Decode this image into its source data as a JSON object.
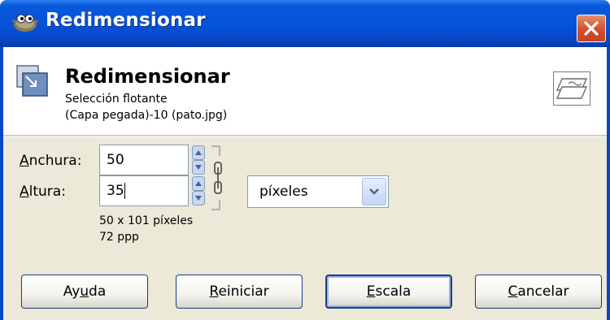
{
  "window": {
    "title": "Redimensionar",
    "icon": "gimp-wilber-icon",
    "close_icon": "close-icon"
  },
  "header": {
    "title": "Redimensionar",
    "subtitle": "Selección flotante",
    "layer": "(Capa pegada)-10 (pato.jpg)",
    "icon": "scale-layer-icon",
    "preview_icon": "layer-preview-icon"
  },
  "form": {
    "width_label_accel": "A",
    "width_label_rest": "nchura:",
    "width_value": "50",
    "height_label_accel": "A",
    "height_label_rest": "ltura:",
    "height_value": "35",
    "unit": "píxeles",
    "size_info": "50 x 101 píxeles",
    "resolution_info": "72 ppp"
  },
  "buttons": {
    "help_pre": "Ay",
    "help_accel": "u",
    "help_post": "da",
    "reset_accel": "R",
    "reset_post": "einiciar",
    "scale_accel": "E",
    "scale_post": "scala",
    "cancel_accel": "C",
    "cancel_post": "ancelar"
  },
  "colors": {
    "titlebar": "#0552d8",
    "client_bg": "#ece9d8",
    "close_button": "#d4532f"
  }
}
